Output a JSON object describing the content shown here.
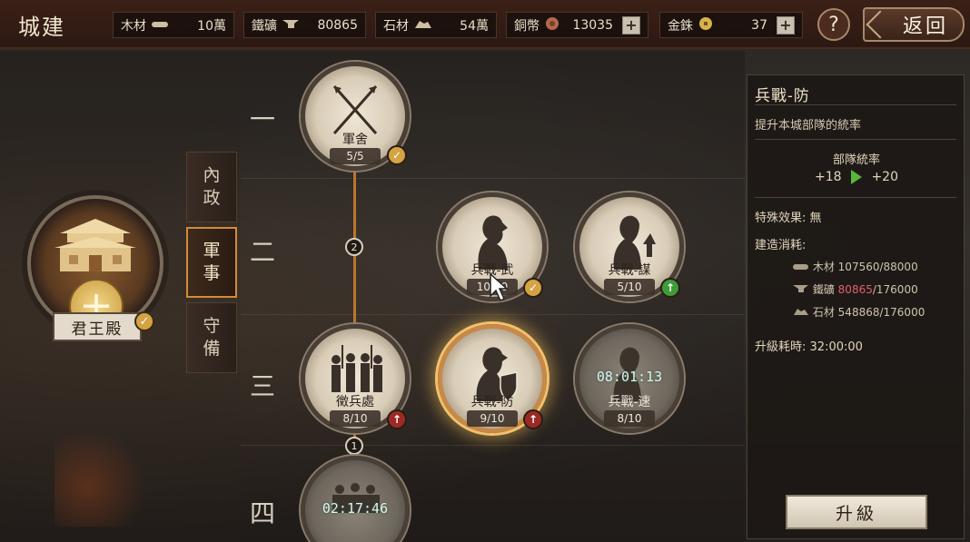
{
  "header": {
    "title": "城建",
    "back_label": "返回",
    "help_label": "?",
    "resources": [
      {
        "label": "木材",
        "value": "10萬",
        "icon": "wood-icon"
      },
      {
        "label": "鐵礦",
        "value": "80865",
        "icon": "iron-icon"
      },
      {
        "label": "石材",
        "value": "54萬",
        "icon": "stone-icon"
      },
      {
        "label": "銅幣",
        "value": "13035",
        "icon": "copper-coin-icon",
        "has_plus": true
      },
      {
        "label": "金銖",
        "value": "37",
        "icon": "gold-coin-icon",
        "has_plus": true
      }
    ],
    "plus": "+"
  },
  "left": {
    "king_label": "君王殿",
    "medal": "十",
    "tabs": [
      {
        "label_1": "內",
        "label_2": "政"
      },
      {
        "label_1": "軍",
        "label_2": "事"
      },
      {
        "label_1": "守",
        "label_2": "備"
      }
    ],
    "active_tab": 1
  },
  "tree": {
    "tiers": [
      "一",
      "二",
      "三",
      "四"
    ],
    "connector_counts": [
      "2",
      "1"
    ],
    "nodes": [
      {
        "name": "軍舍",
        "level": "5/5",
        "badge": "check"
      },
      {
        "name": "兵戰-武",
        "level": "10/10",
        "badge": "check"
      },
      {
        "name": "兵戰-謀",
        "level": "5/10",
        "badge": "up"
      },
      {
        "name": "徵兵處",
        "level": "8/10",
        "badge": "lock"
      },
      {
        "name": "兵戰-防",
        "level": "9/10",
        "badge": "lock",
        "selected": true
      },
      {
        "name": "兵戰-速",
        "level": "8/10",
        "timer": "08:01:13"
      },
      {
        "timer": "02:17:46"
      }
    ]
  },
  "detail": {
    "title": "兵戰-防",
    "description": "提升本城部隊的統率",
    "stat_name": "部隊統率",
    "stat_from": "+18",
    "stat_to": "+20",
    "special_label": "特殊效果:",
    "special_value": "無",
    "cost_label": "建造消耗:",
    "costs": [
      {
        "name": "木材",
        "have": "107560",
        "need": "/88000"
      },
      {
        "name": "鐵礦",
        "have": "80865",
        "need": "/176000",
        "insufficient": true
      },
      {
        "name": "石材",
        "have": "548868",
        "need": "/176000"
      }
    ],
    "time_label": "升級耗時:",
    "time_value": "32:00:00",
    "upgrade_label": "升級"
  },
  "colors": {
    "accent": "#d48a3a",
    "insufficient": "#e06070",
    "check": "#d4a343",
    "up": "#3e9b3a",
    "locked": "#9b2a25"
  }
}
